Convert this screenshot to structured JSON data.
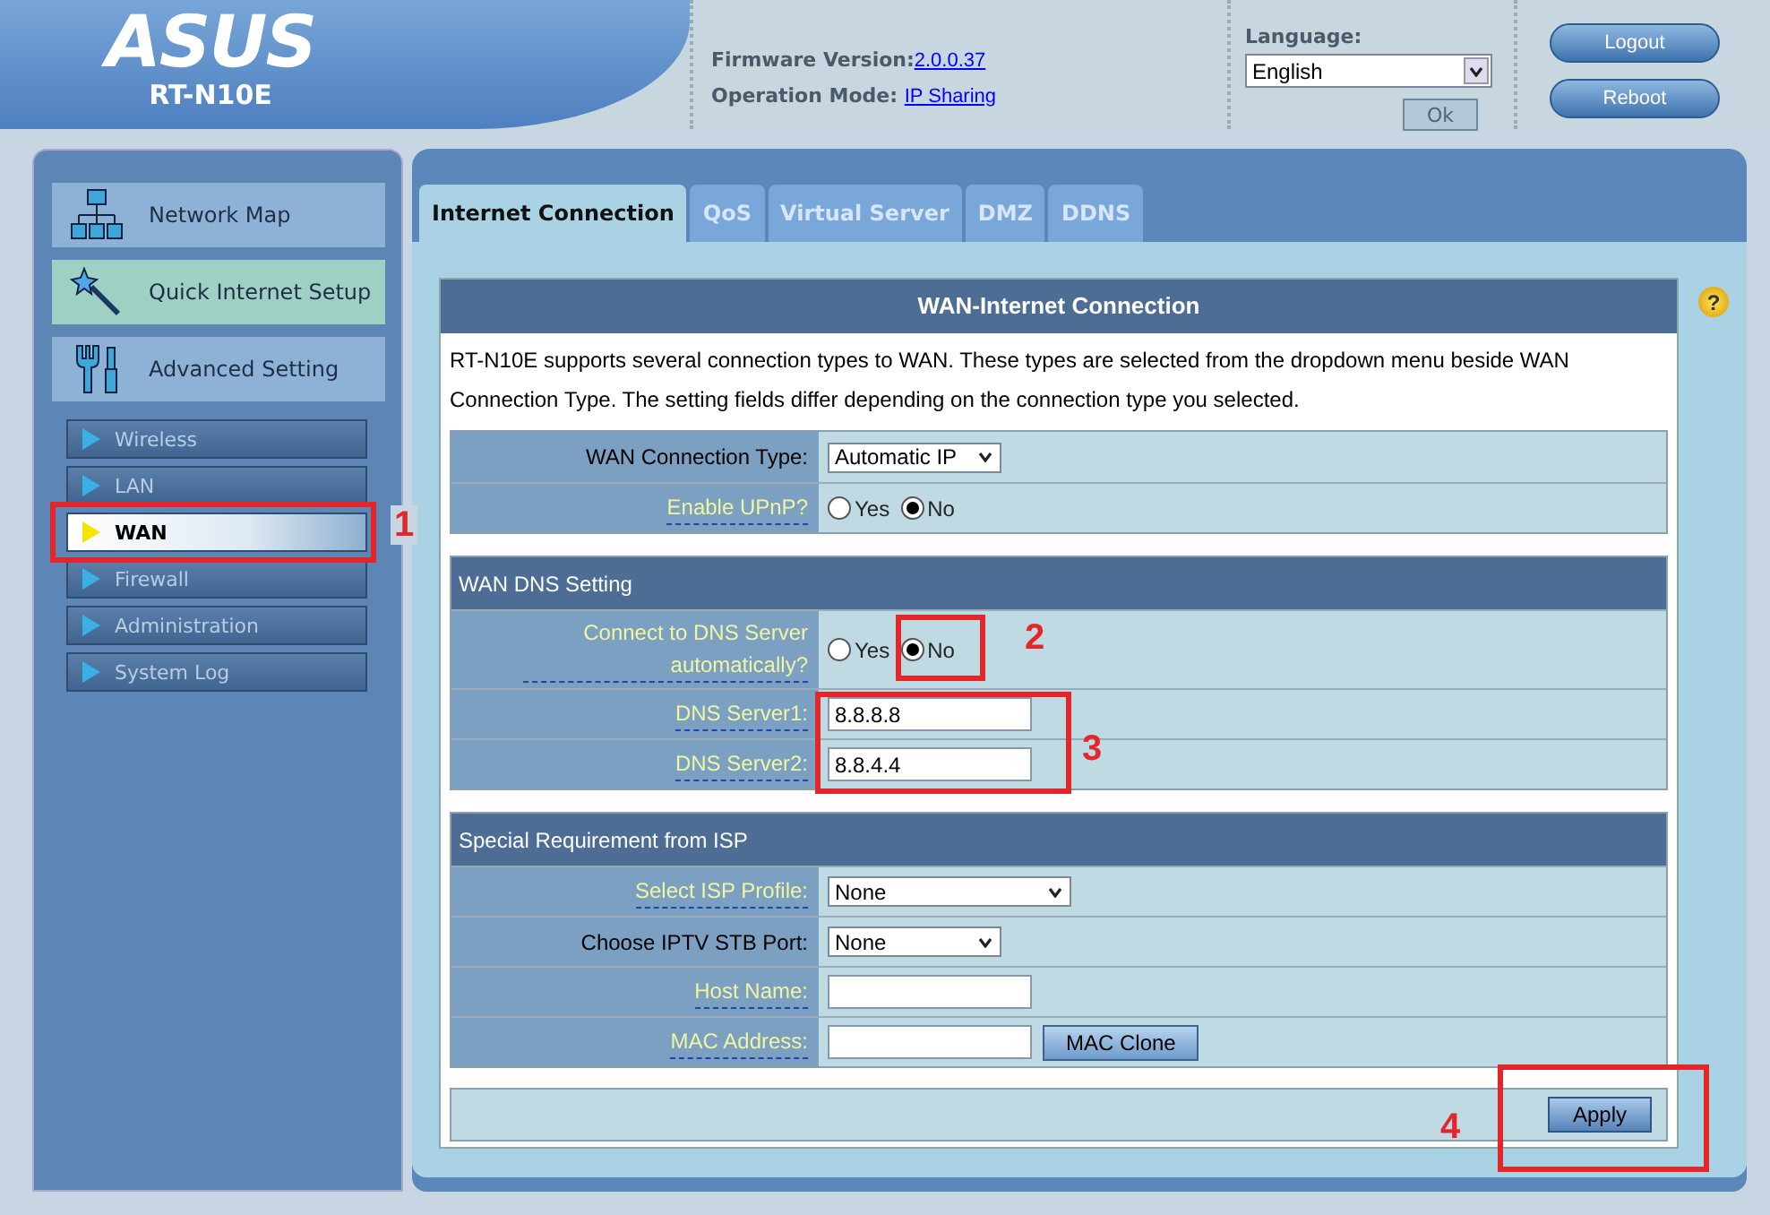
{
  "header": {
    "logo": "ASUS",
    "model": "RT-N10E",
    "firmware_label": "Firmware Version:",
    "firmware_value": "2.0.0.37",
    "mode_label": "Operation Mode:",
    "mode_value": "IP Sharing",
    "language_label": "Language:",
    "language_value": "English",
    "ok_button": {
      "label": "Ok",
      "disabled": true
    },
    "buttons": [
      "Logout",
      "Reboot"
    ]
  },
  "sidebar": {
    "main_items": [
      {
        "label": "Network Map",
        "highlighted": false
      },
      {
        "label": "Quick Internet Setup",
        "highlighted": true
      },
      {
        "label": "Advanced Setting",
        "highlighted": false
      }
    ],
    "sub_items": [
      {
        "label": "Wireless",
        "selected": false
      },
      {
        "label": "LAN",
        "selected": false
      },
      {
        "label": "WAN",
        "selected": true
      },
      {
        "label": "Firewall",
        "selected": false
      },
      {
        "label": "Administration",
        "selected": false
      },
      {
        "label": "System Log",
        "selected": false
      }
    ]
  },
  "tabs": [
    {
      "label": "Internet Connection",
      "selected": true
    },
    {
      "label": "QoS",
      "selected": false
    },
    {
      "label": "Virtual Server",
      "selected": false
    },
    {
      "label": "DMZ",
      "selected": false
    },
    {
      "label": "DDNS",
      "selected": false
    }
  ],
  "help_icon": "?",
  "form": {
    "title": "WAN-Internet Connection",
    "description": "RT-N10E supports several connection types to WAN. These types are selected from the dropdown menu beside WAN Connection Type. The setting fields differ depending on the connection type you selected.",
    "sections": [
      {
        "rows": [
          {
            "label": "WAN Connection Type:",
            "hint": false,
            "kind": "select",
            "value": "Automatic IP"
          },
          {
            "label": "Enable UPnP?",
            "hint": true,
            "kind": "radio",
            "options": [
              {
                "label": "Yes",
                "selected": false
              },
              {
                "label": "No",
                "selected": true
              }
            ]
          }
        ]
      },
      {
        "heading": "WAN DNS Setting",
        "rows": [
          {
            "label": "Connect to DNS Server automatically?",
            "hint": true,
            "kind": "radio",
            "options": [
              {
                "label": "Yes",
                "selected": false
              },
              {
                "label": "No",
                "selected": true
              }
            ]
          },
          {
            "label": "DNS Server1:",
            "hint": true,
            "kind": "text",
            "value": "8.8.8.8"
          },
          {
            "label": "DNS Server2:",
            "hint": true,
            "kind": "text",
            "value": "8.8.4.4"
          }
        ]
      },
      {
        "heading": "Special Requirement from ISP",
        "rows": [
          {
            "label": "Select ISP Profile:",
            "hint": true,
            "kind": "select",
            "value": "None"
          },
          {
            "label": "Choose IPTV STB Port:",
            "hint": false,
            "kind": "select",
            "value": "None"
          },
          {
            "label": "Host Name:",
            "hint": true,
            "kind": "text",
            "value": ""
          },
          {
            "label": "MAC Address:",
            "hint": true,
            "kind": "text_button",
            "value": "",
            "button": "MAC Clone"
          }
        ]
      }
    ],
    "apply_button": "Apply"
  },
  "annotations": [
    {
      "number": "1"
    },
    {
      "number": "2"
    },
    {
      "number": "3"
    },
    {
      "number": "4"
    }
  ]
}
